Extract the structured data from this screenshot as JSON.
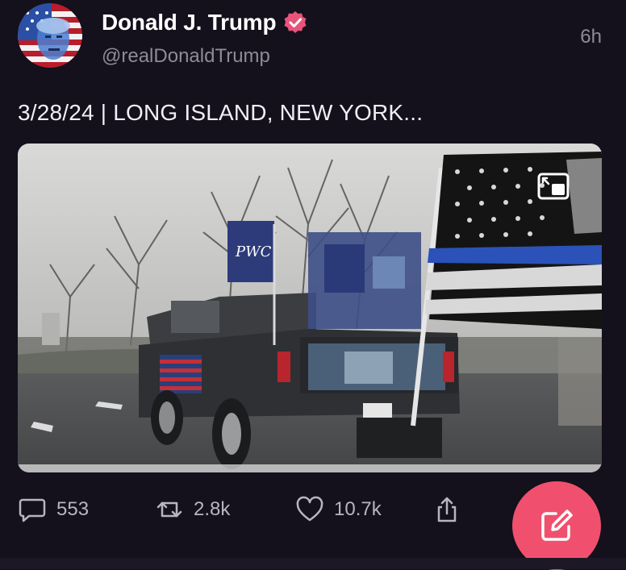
{
  "post": {
    "author": {
      "display_name": "Donald J. Trump",
      "handle": "@realDonaldTrump",
      "verified": true,
      "avatar_icon": "avatar-flag-portrait-icon"
    },
    "timestamp": "6h",
    "text": "3/28/24 | LONG ISLAND, NEW YORK...",
    "media": {
      "type": "video",
      "pip_icon": "picture-in-picture-icon",
      "flag_sign_text": "PWC"
    },
    "actions": {
      "replies": {
        "icon": "reply-bubble-icon",
        "count": "553"
      },
      "reposts": {
        "icon": "repost-icon",
        "count": "2.8k"
      },
      "likes": {
        "icon": "heart-icon",
        "count": "10.7k"
      },
      "share": {
        "icon": "share-icon"
      }
    }
  },
  "compose_button": {
    "icon": "compose-icon",
    "color": "#f0506e"
  },
  "colors": {
    "background": "#14101c",
    "secondary_text": "#8e8a97",
    "verified_badge": "#e8547a",
    "accent": "#f0506e"
  }
}
